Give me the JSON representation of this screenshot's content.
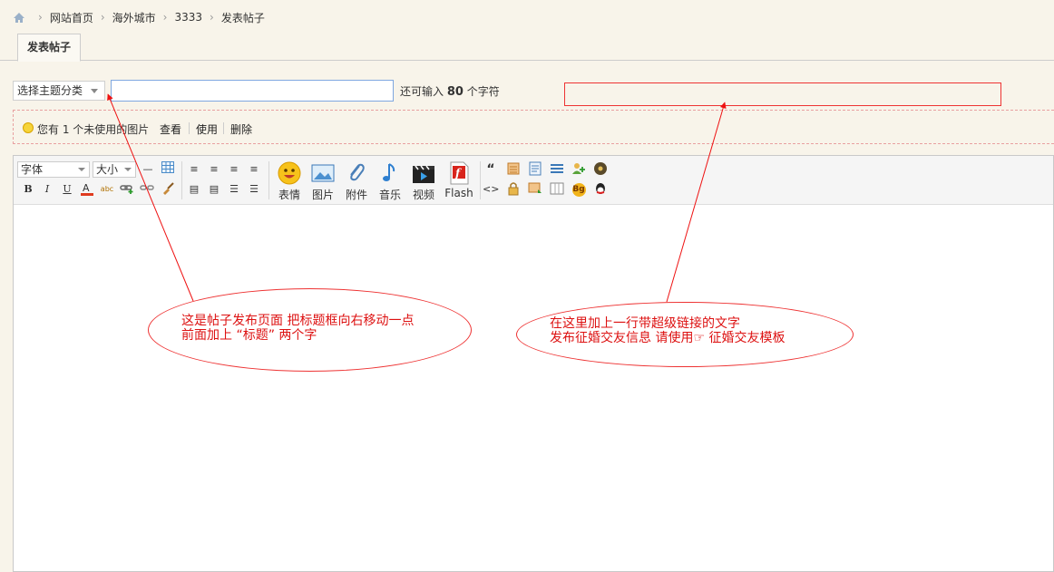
{
  "breadcrumb": {
    "items": [
      "网站首页",
      "海外城市",
      "3333",
      "发表帖子"
    ]
  },
  "tab": {
    "label": "发表帖子"
  },
  "subject": {
    "category_label": "选择主题分类",
    "title_value": "",
    "remaining_prefix": "还可输入",
    "remaining_count": "80",
    "remaining_suffix": "个字符"
  },
  "notice": {
    "text": "您有 1 个未使用的图片",
    "view": "查看",
    "use": "使用",
    "delete": "删除"
  },
  "toolbar": {
    "font_label": "字体",
    "size_label": "大小",
    "emoticon": "表情",
    "image": "图片",
    "attachment": "附件",
    "music": "音乐",
    "video": "视频",
    "flash": "Flash",
    "bold": "B",
    "italic": "I",
    "underline": "U",
    "quote": "“",
    "code": "<>",
    "bg": "Bg",
    "abc": "abc"
  },
  "annotations": {
    "left_line1": "这是帖子发布页面  把标题框向右移动一点",
    "left_line2": "前面加上 “标题” 两个字",
    "right_line1": "在这里加上一行带超级链接的文字",
    "right_line2": "发布征婚交友信息  请使用☞  征婚交友模板"
  },
  "colors": {
    "annotation": "#dd1111",
    "accent_border": "#7fa7e0",
    "page_bg": "#f8f4ea"
  }
}
